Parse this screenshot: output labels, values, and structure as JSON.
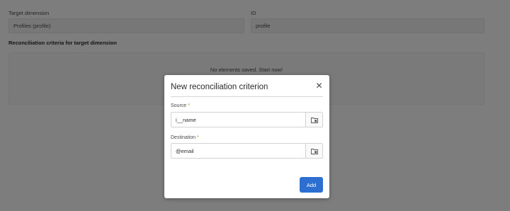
{
  "background": {
    "target_dimension_label": "Target dimension",
    "target_dimension_value": "Profiles (profile)",
    "id_label": "ID",
    "id_value": "profile",
    "criteria_section_title": "Reconciliation criteria for target dimension",
    "empty_message": "No elements saved. Start now!"
  },
  "modal": {
    "title": "New reconciliation criterion",
    "close_glyph": "✕",
    "source": {
      "label": "Source",
      "required_mark": "*",
      "value": "i__name"
    },
    "destination": {
      "label": "Destination",
      "required_mark": "*",
      "value": "@email"
    },
    "picker_icon": "folder-picker-icon",
    "add_label": "Add"
  },
  "colors": {
    "primary": "#2d6fd0",
    "required": "#e68619",
    "overlay": "rgba(0,0,0,0.5)"
  }
}
